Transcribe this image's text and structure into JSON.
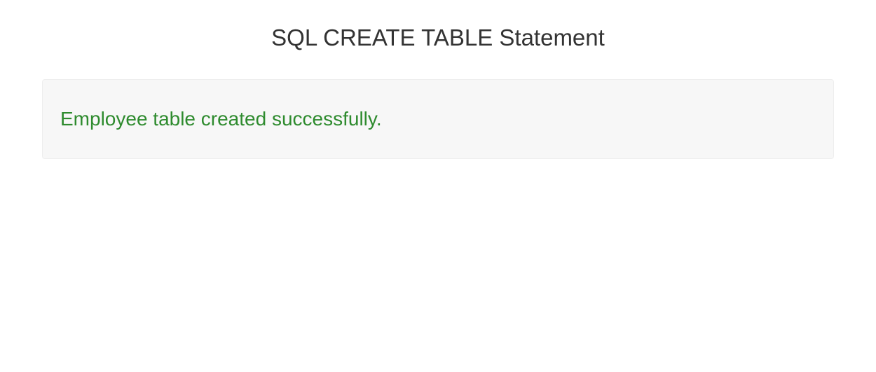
{
  "header": {
    "title": "SQL CREATE TABLE Statement"
  },
  "output": {
    "message": "Employee table created successfully."
  }
}
